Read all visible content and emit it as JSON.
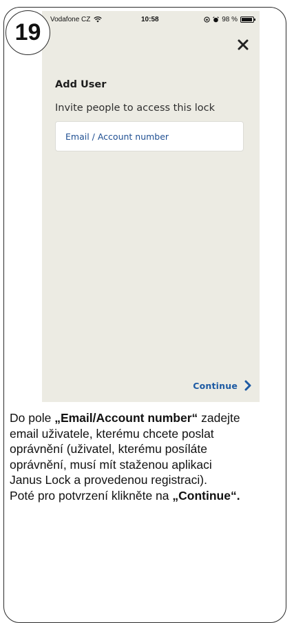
{
  "step": {
    "number": "19"
  },
  "status_bar": {
    "carrier": "Vodafone CZ",
    "time": "10:58",
    "battery": "98 %",
    "battery_level": 0.98
  },
  "screen": {
    "title": "Add User",
    "subtitle": "Invite people to access this lock",
    "email_placeholder": "Email / Account number",
    "continue_label": "Continue",
    "close_icon": "close-icon",
    "accent_color": "#1d5aa3",
    "background_color": "#ecebe3"
  },
  "instructions": {
    "line1_prefix": "Do pole ",
    "line1_highlight": "„Email/Account number“",
    "line1_suffix": " zadejte",
    "line2": "email uživatele, kterému chcete poslat",
    "line3": "oprávnění (uživatel, kterému posíláte",
    "line4": "oprávnění, musí mít staženou aplikaci",
    "line5": "Janus Lock a provedenou registraci).",
    "line6_prefix": "Poté pro potvrzení klikněte na ",
    "line6_highlight": "„Continue“."
  }
}
